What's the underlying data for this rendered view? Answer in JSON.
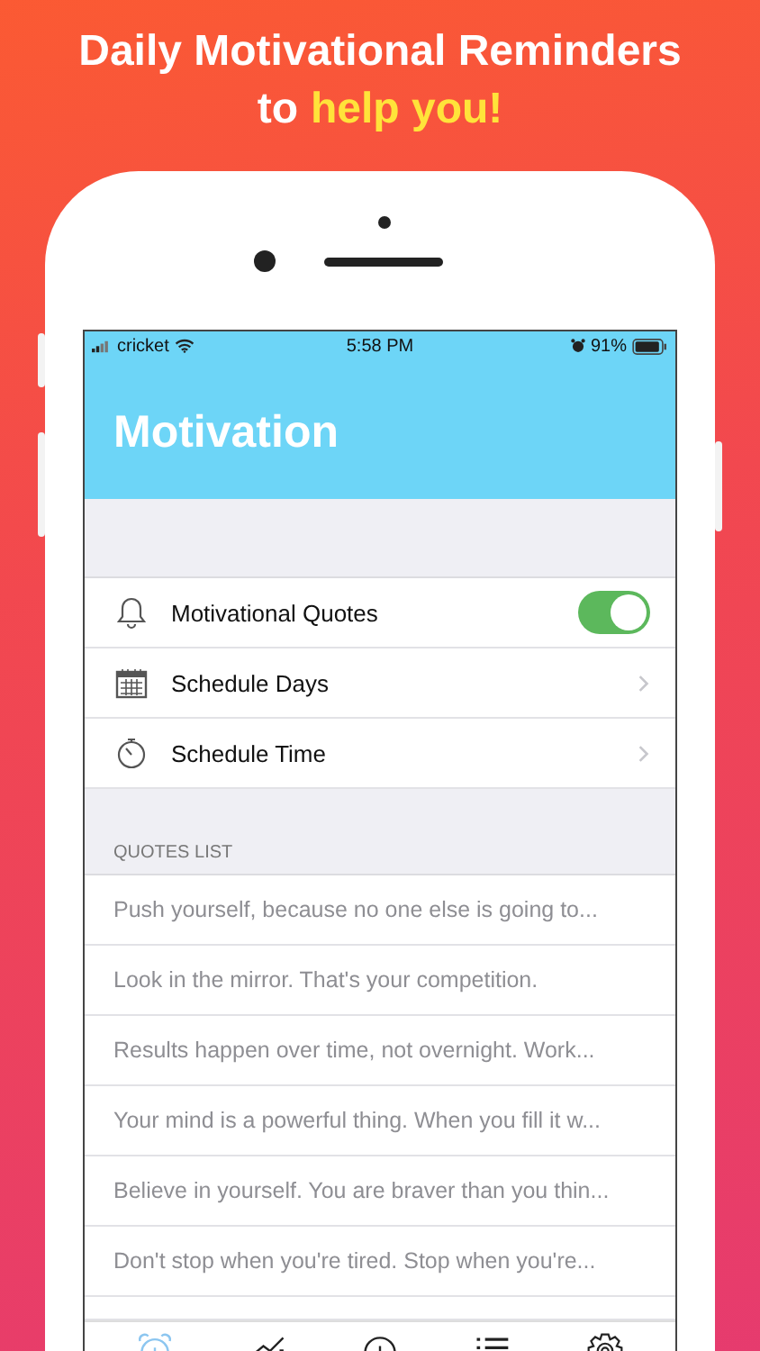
{
  "headline": {
    "line1": "Daily Motivational Reminders",
    "line2_prefix": "to",
    "line2_highlight": "help you!"
  },
  "status_bar": {
    "carrier": "cricket",
    "time": "5:58 PM",
    "battery": "91%"
  },
  "nav": {
    "title": "Motivation"
  },
  "settings": [
    {
      "kind": "toggle",
      "label": "Motivational Quotes",
      "on": true
    },
    {
      "kind": "link",
      "label": "Schedule Days"
    },
    {
      "kind": "link",
      "label": "Schedule Time"
    }
  ],
  "quotes_section": {
    "header": "QUOTES LIST",
    "quotes": [
      "Push yourself, because no one else is going to...",
      "Look in the mirror. That's your competition.",
      "Results happen over time, not overnight. Work...",
      "Your mind is a powerful thing. When you fill it w...",
      "Believe in yourself. You are braver than you thin...",
      "Don't stop when you're tired. Stop when you're..."
    ]
  },
  "tab_bar": [
    {
      "selected": true
    },
    {
      "selected": false
    },
    {
      "selected": false
    },
    {
      "selected": false
    },
    {
      "selected": false
    }
  ]
}
